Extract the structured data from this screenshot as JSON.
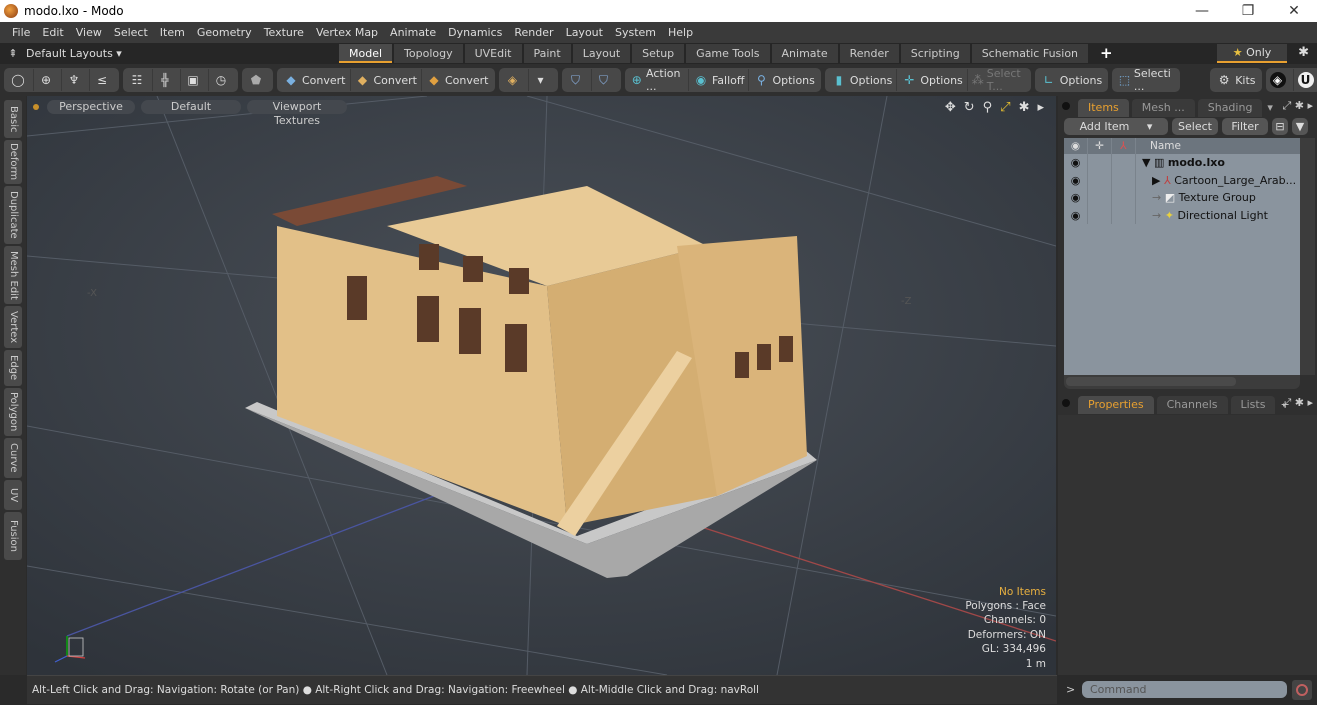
{
  "window": {
    "title": "modo.lxo - Modo",
    "minimize": "—",
    "restore": "❐",
    "close": "✕"
  },
  "menu": [
    "File",
    "Edit",
    "View",
    "Select",
    "Item",
    "Geometry",
    "Texture",
    "Vertex Map",
    "Animate",
    "Dynamics",
    "Render",
    "Layout",
    "System",
    "Help"
  ],
  "layoutbar": {
    "preset": "Default Layouts ▾",
    "tabs": [
      "Model",
      "Topology",
      "UVEdit",
      "Paint",
      "Layout",
      "Setup",
      "Game Tools",
      "Animate",
      "Render",
      "Scripting",
      "Schematic Fusion"
    ],
    "active_tab": "Model",
    "add": "+",
    "only_label": "Only",
    "star": "★",
    "gear": "✱"
  },
  "toolbar": {
    "convert1": "Convert",
    "convert2": "Convert",
    "convert3": "Convert",
    "action": "Action ...",
    "falloff": "Falloff",
    "options1": "Options",
    "options2": "Options",
    "options3": "Options",
    "select_t": "Select T...",
    "options4": "Options",
    "selecti": "Selecti ...",
    "kits": "Kits"
  },
  "sidetabs": [
    "Basic",
    "Deform",
    "Duplicate",
    "Mesh Edit",
    "Vertex",
    "Edge",
    "Polygon",
    "Curve",
    "UV",
    "Fusion"
  ],
  "viewport": {
    "view": "Perspective",
    "shading": "Default",
    "textures": "Viewport Textures",
    "axis_x": "-X",
    "axis_z": "-Z",
    "stats": {
      "selection": "No Items",
      "polygons": "Polygons : Face",
      "channels": "Channels: 0",
      "deformers": "Deformers: ON",
      "gl": "GL: 334,496",
      "scale": "1 m"
    }
  },
  "status": {
    "hint": "Alt-Left Click and Drag: Navigation: Rotate (or Pan) ● Alt-Right Click and Drag: Navigation: Freewheel ● Alt-Middle Click and Drag: navRoll"
  },
  "command": {
    "prompt": ">",
    "placeholder": "Command"
  },
  "items_panel": {
    "tabs": [
      "Items",
      "Mesh ...",
      "Shading"
    ],
    "active": "Items",
    "add_item": "Add Item",
    "select": "Select",
    "filter": "Filter",
    "col_name": "Name",
    "rows": [
      {
        "name": "modo.lxo",
        "indent": 0,
        "expander": "▼",
        "icon": "🎬",
        "bold": true
      },
      {
        "name": "Cartoon_Large_Arab...",
        "indent": 1,
        "expander": "▶",
        "icon": "⅄",
        "bold": false
      },
      {
        "name": "Texture Group",
        "indent": 1,
        "expander": "→",
        "icon": "◩",
        "bold": false
      },
      {
        "name": "Directional Light",
        "indent": 1,
        "expander": "→",
        "icon": "✦",
        "bold": false
      }
    ]
  },
  "props_panel": {
    "tabs": [
      "Properties",
      "Channels",
      "Lists"
    ],
    "active": "Properties",
    "add": "+"
  }
}
